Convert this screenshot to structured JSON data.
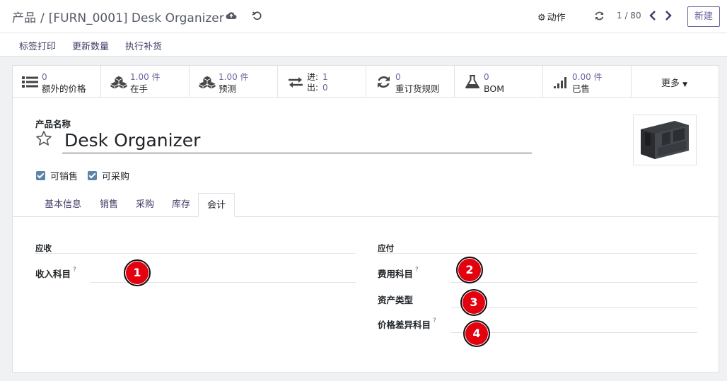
{
  "breadcrumb": {
    "parent": "产品",
    "separator": "/",
    "current": "[FURN_0001] Desk Organizer"
  },
  "header": {
    "action_label": "动作",
    "pager": "1 / 80",
    "new_label": "新建"
  },
  "actionbar": {
    "buttons": [
      "标签打印",
      "更新数量",
      "执行补货"
    ]
  },
  "smart_buttons": [
    {
      "value": "0",
      "label": "额外的价格",
      "icon": "list-icon"
    },
    {
      "value": "1.00 件",
      "label": "在手",
      "icon": "cubes-icon"
    },
    {
      "value": "1.00 件",
      "label": "预测",
      "icon": "cubes-icon"
    },
    {
      "in_label": "进:",
      "in_value": "1",
      "out_label": "出:",
      "out_value": "0",
      "icon": "exchange-icon"
    },
    {
      "value": "0",
      "label": "重订货规则",
      "icon": "refresh-icon"
    },
    {
      "value": "0",
      "label": "BOM",
      "icon": "flask-icon"
    },
    {
      "value": "0.00 件",
      "label": "已售",
      "icon": "signal-icon"
    }
  ],
  "more_label": "更多",
  "product": {
    "name_label": "产品名称",
    "name": "Desk Organizer",
    "can_sell_label": "可销售",
    "can_purchase_label": "可采购"
  },
  "tabs": [
    "基本信息",
    "销售",
    "采购",
    "库存",
    "会计"
  ],
  "active_tab": "会计",
  "accounting": {
    "receivable_title": "应收",
    "payable_title": "应付",
    "income_account_label": "收入科目",
    "expense_account_label": "费用科目",
    "asset_type_label": "资产类型",
    "price_diff_label": "价格差异科目",
    "help_mark": "?"
  },
  "markers": [
    "1",
    "2",
    "3",
    "4"
  ],
  "colors": {
    "brand": "#71639e",
    "marker": "#e3000f",
    "checkbox": "#5b84a8"
  }
}
